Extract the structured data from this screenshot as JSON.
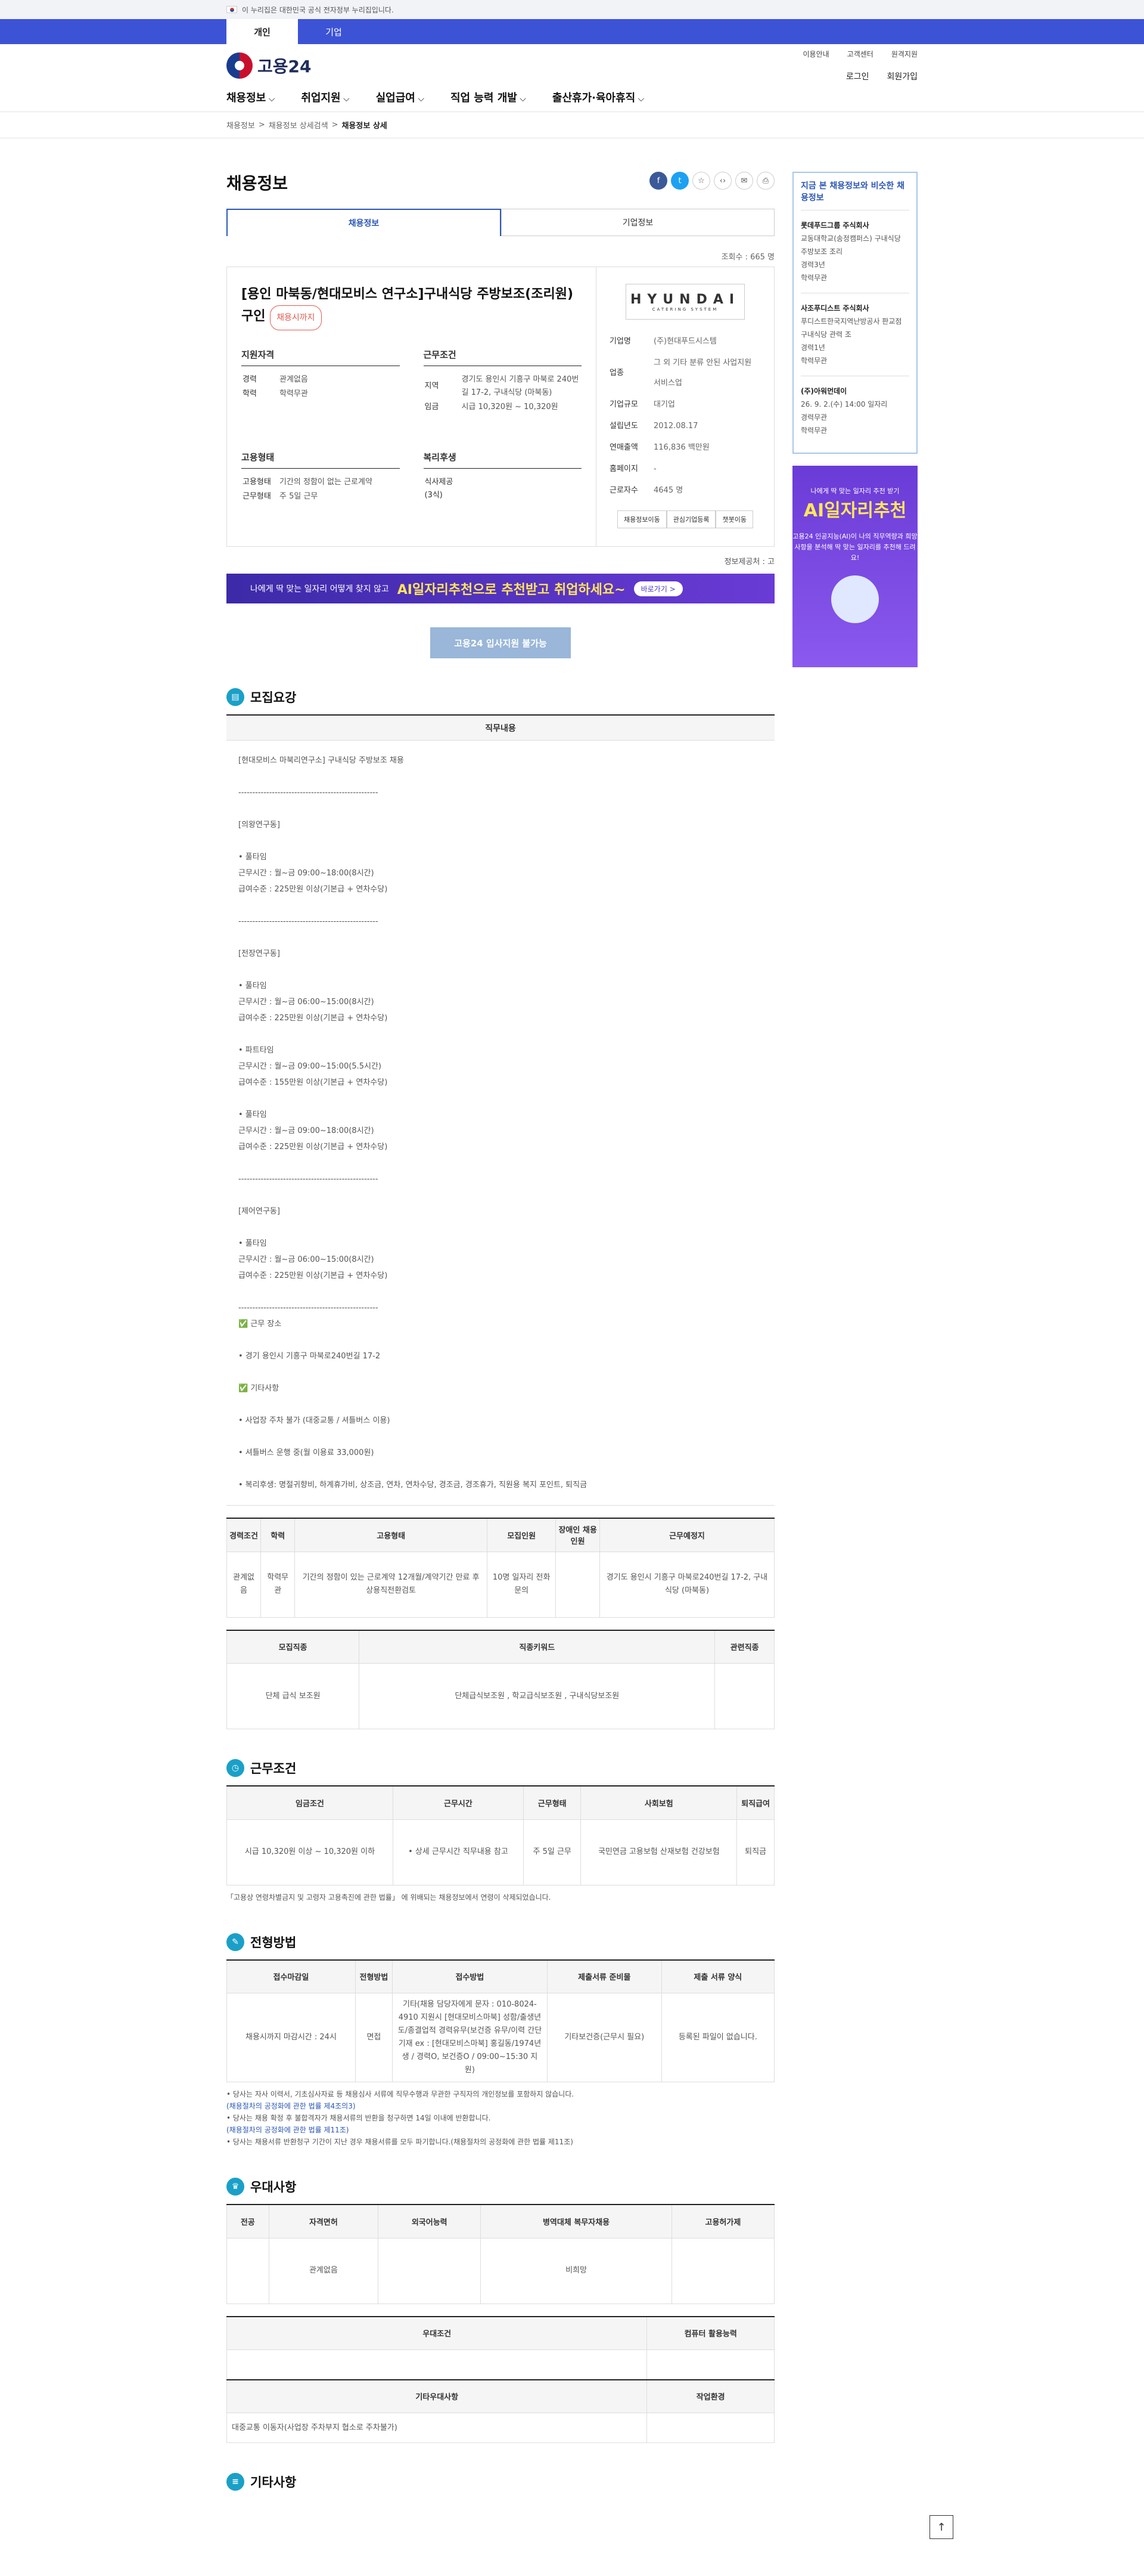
{
  "gov": {
    "text": "이 누리집은 대한민국 공식 전자정부 누리집입니다."
  },
  "usertype": {
    "tabs": [
      "개인",
      "기업"
    ]
  },
  "logo": {
    "name": "고용24"
  },
  "toplinks": [
    "이용안내",
    "고객센터",
    "원격지원"
  ],
  "user": {
    "login": "로그인",
    "join": "회원가입"
  },
  "gnb": [
    "채용정보",
    "취업지원",
    "실업급여",
    "직업 능력 개발",
    "출산휴가·육아휴직"
  ],
  "breadcrumb": [
    "채용정보",
    "채용정보 상세검색",
    "채용정보 상세"
  ],
  "page": {
    "title": "채용정보",
    "tabs": [
      "채용정보",
      "기업정보"
    ],
    "views": "조회수 : 665 명"
  },
  "job": {
    "title": "[용인 마북동/현대모비스 연구소]구내식당 주방보조(조리원) 구인",
    "status": "채용시까지",
    "qual": {
      "head": "지원자격",
      "career_k": "경력",
      "career": "관계없음",
      "edu_k": "학력",
      "edu": "학력무관"
    },
    "cond": {
      "head": "근무조건",
      "area_k": "지역",
      "area": "경기도 용인시 기흥구 마북로 240번길 17-2, 구내식당 (마북동)",
      "pay_k": "임금",
      "pay": "시급 10,320원 ~ 10,320원"
    },
    "emp": {
      "head": "고용형태",
      "type_k": "고용형태",
      "type": "기간의 정함이 없는 근로계약",
      "time_k": "근무형태",
      "time": "주 5일 근무"
    },
    "welfare": {
      "head": "복리후생",
      "v": "식사제공(3식)"
    }
  },
  "company": {
    "logo": "HYUNDAI",
    "sub": "CATERING SYSTEM",
    "rows": [
      [
        "기업명",
        "(주)현대푸드시스템"
      ],
      [
        "업종",
        "그 외 기타 분류 안된 사업지원 서비스업"
      ],
      [
        "기업규모",
        "대기업"
      ],
      [
        "설립년도",
        "2012.08.17"
      ],
      [
        "연매출액",
        "116,836 백만원"
      ],
      [
        "홈페이지",
        "-"
      ],
      [
        "근로자수",
        "4645 명"
      ]
    ],
    "btns": [
      "채용정보이동",
      "관심기업등록",
      "챗봇이동"
    ]
  },
  "source": "정보제공처 : 고",
  "banner": {
    "a": "나에게 딱 맞는 일자리 어떻게 찾지 않고",
    "b": "AI일자리추천으로 추천받고 취업하세요~",
    "c": "바로가기 >"
  },
  "apply": "고용24 입사지원 불가능",
  "sec1": {
    "title": "모집요강",
    "head": "직무내용",
    "body": "[현대모비스 마북리연구소] 구내식당 주방보조 채용\n\n--------------------------------------------------\n\n[의왕연구동]\n\n• 풀타임\n근무시간 : 월~금 09:00~18:00(8시간)\n급여수준 : 225만원 이상(기본급 + 연차수당)\n\n--------------------------------------------------\n\n[전장연구동]\n\n• 풀타임\n근무시간 : 월~금 06:00~15:00(8시간)\n급여수준 : 225만원 이상(기본급 + 연차수당)\n\n• 파트타임\n근무시간 : 월~금 09:00~15:00(5.5시간)\n급여수준 : 155만원 이상(기본급 + 연차수당)\n\n• 풀타임\n근무시간 : 월~금 09:00~18:00(8시간)\n급여수준 : 225만원 이상(기본급 + 연차수당)\n\n--------------------------------------------------\n\n[제어연구동]\n\n• 풀타임\n근무시간 : 월~금 06:00~15:00(8시간)\n급여수준 : 225만원 이상(기본급 + 연차수당)\n\n--------------------------------------------------\n✅ 근무 장소\n\n• 경기 용인시 기흥구 마북로240번길 17-2\n\n✅ 기타사항\n\n• 사업장 주차 불가 (대중교통 / 셔틀버스 이용)\n\n• 셔틀버스 운행 중(월 이용료 33,000원)\n\n• 복리후생: 명절귀향비, 하계휴가비, 상조금, 연차, 연차수당, 경조금, 경조휴가, 직원용 복지 포인트, 퇴직금",
    "t1h": [
      "경력조건",
      "학력",
      "고용형태",
      "모집인원",
      "장애인 채용인원",
      "근무예정지"
    ],
    "t1r": [
      "관계없음",
      "학력무관",
      "기간의 정함이 있는 근로계약 12개월/계약기간 만료 후 상용직전환검토",
      "10명 일자리 전화문의",
      "",
      "경기도 용인시 기흥구 마북로240번길 17-2, 구내식당 (마북동)"
    ],
    "t2h": [
      "모집직종",
      "직종키워드",
      "관련직종"
    ],
    "t2r": [
      "단체 급식 보조원",
      "단체급식보조원 , 학교급식보조원 , 구내식당보조원",
      ""
    ]
  },
  "sec2": {
    "title": "근무조건",
    "th": [
      "임금조건",
      "근무시간",
      "근무형태",
      "사회보험",
      "퇴직급여"
    ],
    "tr": [
      "시급 10,320원 이상 ~ 10,320원 이하",
      "• 상세 근무시간 직무내용 참고",
      "주 5일 근무",
      "국민연금 고용보험 산재보험 건강보험",
      "퇴직금"
    ],
    "note": "「고용상 연령차별금지 및 고령자 고용촉진에 관한 법률」 에 위배되는 채용정보에서 연령이 삭제되었습니다."
  },
  "sec3": {
    "title": "전형방법",
    "th": [
      "접수마감일",
      "전형방법",
      "접수방법",
      "제출서류 준비물",
      "제출 서류 양식"
    ],
    "tr": [
      "채용시까지 마감시간 : 24시",
      "면접",
      "기타(채용 담당자에게 문자 : 010-8024-4910 지원시 [현대모비스마북] 성함/출생년도/종결업적 경력유무(보건증 유무/이력 간단 기재 ex : [현대모비스마북] 홍길동/1974년생 / 경력O, 보건증O / 09:00~15:30 지원)",
      "기타보건증(근무시 필요)",
      "등록된 파일이 없습니다."
    ],
    "notes": [
      "• 당사는 자사 이력서, 기초심사자료 등 채용심사 서류에 직무수행과 무관한 구직자의 개인정보를 포함하지 않습니다.",
      "(채용절차의 공정화에 관한 법률 제4조의3)",
      "• 당사는 채용 확정 후 불합격자가 채용서류의 반환을 청구하면 14일 이내에 반환합니다.",
      "(채용절차의 공정화에 관한 법률 제11조)",
      "• 당사는 채용서류 반환청구 기간이 지난 경우 채용서류를 모두 파기합니다.(채용절차의 공정화에 관한 법률 제11조)"
    ]
  },
  "sec4": {
    "title": "우대사항",
    "th": [
      "전공",
      "자격면허",
      "외국어능력",
      "병역대체 복무자채용",
      "고용허가제"
    ],
    "tr": [
      "",
      "관계없음",
      "",
      "비희망",
      ""
    ],
    "th2": [
      "우대조건",
      "컴퓨터 활용능력"
    ],
    "th3": [
      "기타우대사항",
      "작업환경"
    ],
    "tr3": [
      "대중교통 이동자(사업장 주차부지 협소로 주차불가)",
      ""
    ]
  },
  "sec5": {
    "title": "기타사항"
  },
  "side": {
    "head": "지금 본 채용정보와 비슷한 채용정보",
    "items": [
      [
        "롯데푸드그룹 주식회사",
        "교동대학교(송정캠퍼스) 구내식당 주방보조 조리",
        "경력3년",
        "학력무관"
      ],
      [
        "사조푸디스트 주식회사",
        "푸디스트한국지역난방공사 판교점 구내식당 관력 조",
        "경력1년",
        "학력무관"
      ],
      [
        "(주)아워먼데이",
        "26. 9. 2.(수) 14:00 일자리",
        "경력무관",
        "학력무관"
      ]
    ],
    "ad": {
      "small": "나에게 딱 맞는 일자리 추천 받기",
      "big": "AI일자리추천",
      "desc": "고용24 인공지능(AI)이 나의 직무역량과 희망 사항을 분석해 딱 맞는 일자리를 추천해 드려요!"
    }
  },
  "top": "↑"
}
